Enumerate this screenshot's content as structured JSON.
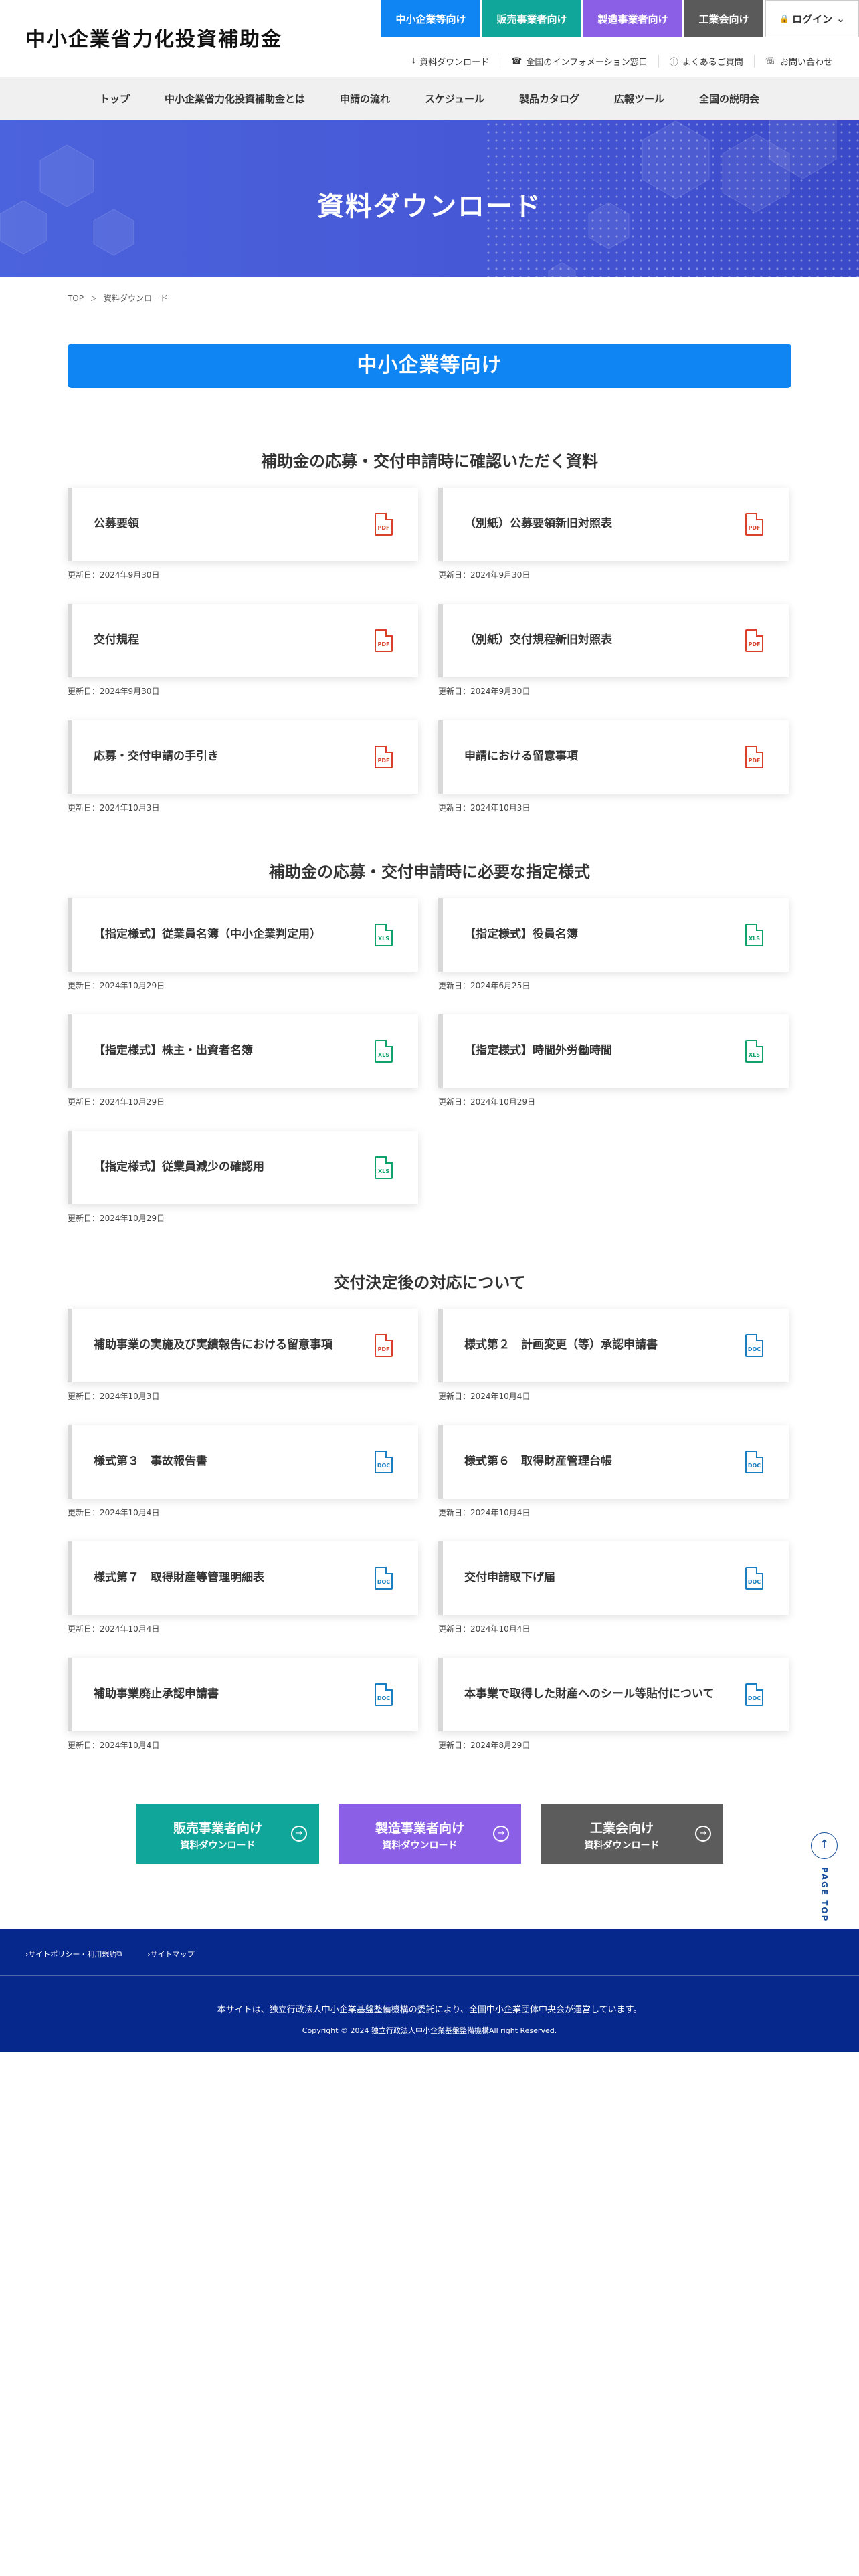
{
  "site": {
    "logo": "中小企業省力化投資補助金"
  },
  "top_tabs": [
    {
      "label": "中小企業等向け",
      "color": "#0e85f2",
      "width": 148
    },
    {
      "label": "販売事業者向け",
      "color": "#10a699",
      "width": 148
    },
    {
      "label": "製造事業者向け",
      "color": "#8b60e6",
      "width": 148
    },
    {
      "label": "工業会向け",
      "color": "#5a5a5a",
      "width": 118
    },
    {
      "label": "ログイン",
      "color": "#ffffff",
      "width": 140
    }
  ],
  "util_links": [
    {
      "icon": "download-icon",
      "glyph": "⤓",
      "label": "資料ダウンロード"
    },
    {
      "icon": "phone-icon",
      "glyph": "☎",
      "label": "全国のインフォメーション窓口"
    },
    {
      "icon": "question-icon",
      "glyph": "ⓘ",
      "label": "よくあるご質問"
    },
    {
      "icon": "phone-icon",
      "glyph": "☏",
      "label": "お問い合わせ"
    }
  ],
  "nav": [
    "トップ",
    "中小企業省力化投資補助金とは",
    "申請の流れ",
    "スケジュール",
    "製品カタログ",
    "広報ツール",
    "全国の説明会"
  ],
  "hero": {
    "title": "資料ダウンロード"
  },
  "breadcrumb": {
    "home": "TOP",
    "sep": "＞",
    "current": "資料ダウンロード"
  },
  "main_banner": "中小企業等向け",
  "sections": [
    {
      "title": "補助金の応募・交付申請時に確認いただく資料",
      "items": [
        {
          "label": "公募要領",
          "type": "pdf",
          "date": "更新日：2024年9月30日"
        },
        {
          "label": "（別紙）公募要領新旧対照表",
          "type": "pdf",
          "date": "更新日：2024年9月30日"
        },
        {
          "label": "交付規程",
          "type": "pdf",
          "date": "更新日：2024年9月30日"
        },
        {
          "label": "（別紙）交付規程新旧対照表",
          "type": "pdf",
          "date": "更新日：2024年9月30日"
        },
        {
          "label": "応募・交付申請の手引き",
          "type": "pdf",
          "date": "更新日：2024年10月3日"
        },
        {
          "label": "申請における留意事項",
          "type": "pdf",
          "date": "更新日：2024年10月3日"
        }
      ]
    },
    {
      "title": "補助金の応募・交付申請時に必要な指定様式",
      "items": [
        {
          "label": "【指定様式】従業員名簿（中小企業判定用）",
          "type": "xls",
          "date": "更新日：2024年10月29日"
        },
        {
          "label": "【指定様式】役員名簿",
          "type": "xls",
          "date": "更新日：2024年6月25日"
        },
        {
          "label": "【指定様式】株主・出資者名簿",
          "type": "xls",
          "date": "更新日：2024年10月29日"
        },
        {
          "label": "【指定様式】時間外労働時間",
          "type": "xls",
          "date": "更新日：2024年10月29日"
        },
        {
          "label": "【指定様式】従業員減少の確認用",
          "type": "xls",
          "date": "更新日：2024年10月29日"
        }
      ]
    },
    {
      "title": "交付決定後の対応について",
      "items": [
        {
          "label": "補助事業の実施及び実績報告における留意事項",
          "type": "pdf",
          "date": "更新日：2024年10月3日"
        },
        {
          "label": "様式第２　計画変更（等）承認申請書",
          "type": "doc",
          "date": "更新日：2024年10月4日"
        },
        {
          "label": "様式第３　事故報告書",
          "type": "doc",
          "date": "更新日：2024年10月4日"
        },
        {
          "label": "様式第６　取得財産管理台帳",
          "type": "doc",
          "date": "更新日：2024年10月4日"
        },
        {
          "label": "様式第７　取得財産等管理明細表",
          "type": "doc",
          "date": "更新日：2024年10月4日"
        },
        {
          "label": "交付申請取下げ届",
          "type": "doc",
          "date": "更新日：2024年10月4日"
        },
        {
          "label": "補助事業廃止承認申請書",
          "type": "doc",
          "date": "更新日：2024年10月4日"
        },
        {
          "label": "本事業で取得した財産へのシール等貼付について",
          "type": "doc",
          "date": "更新日：2024年8月29日"
        }
      ]
    }
  ],
  "file_icon_text": {
    "pdf": "PDF",
    "xls": "XLS",
    "doc": "DOC"
  },
  "cta": [
    {
      "title": "販売事業者向け",
      "sub": "資料ダウンロード",
      "color": "#10a699"
    },
    {
      "title": "製造事業者向け",
      "sub": "資料ダウンロード",
      "color": "#8b60e6"
    },
    {
      "title": "工業会向け",
      "sub": "資料ダウンロード",
      "color": "#5c5c5c"
    }
  ],
  "pagetop": "PAGE TOP",
  "footer": {
    "links": [
      "サイトポリシー・利用規約",
      "サイトマップ"
    ],
    "note": "本サイトは、独立行政法人中小企業基盤整備機構の委託により、全国中小企業団体中央会が運営しています。",
    "copyright": "Copyright © 2024 独立行政法人中小企業基盤整備機構All right Reserved."
  }
}
